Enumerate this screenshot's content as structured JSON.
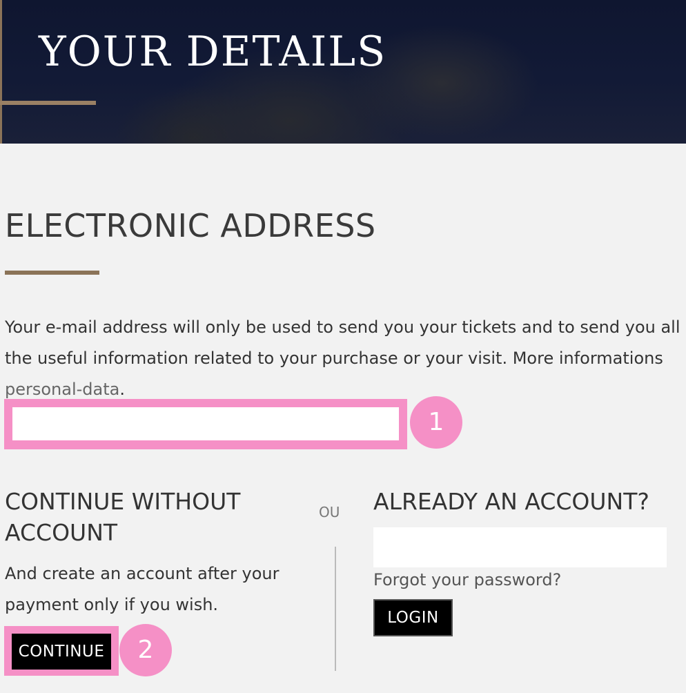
{
  "hero": {
    "title": "YOUR DETAILS"
  },
  "electronic_address": {
    "title": "ELECTRONIC ADDRESS",
    "info_text": "Your e-mail address will only be used to send you your tickets and to send you all the useful information related to your purchase or your visit. More informations ",
    "info_link": "personal-data",
    "info_end": ".",
    "email_value": "",
    "marker": "1"
  },
  "guest": {
    "title": "CONTINUE WITHOUT ACCOUNT",
    "text": "And create an account after your payment only if you wish.",
    "button_label": "CONTINUE",
    "marker": "2"
  },
  "separator": {
    "label": "OU"
  },
  "account": {
    "title": "ALREADY AN ACCOUNT?",
    "input_value": "",
    "forgot_label": "Forgot your password?",
    "login_label": "LOGIN"
  },
  "colors": {
    "accent": "#8b7358",
    "highlight": "#f590c6",
    "background": "#f2f2f2"
  }
}
